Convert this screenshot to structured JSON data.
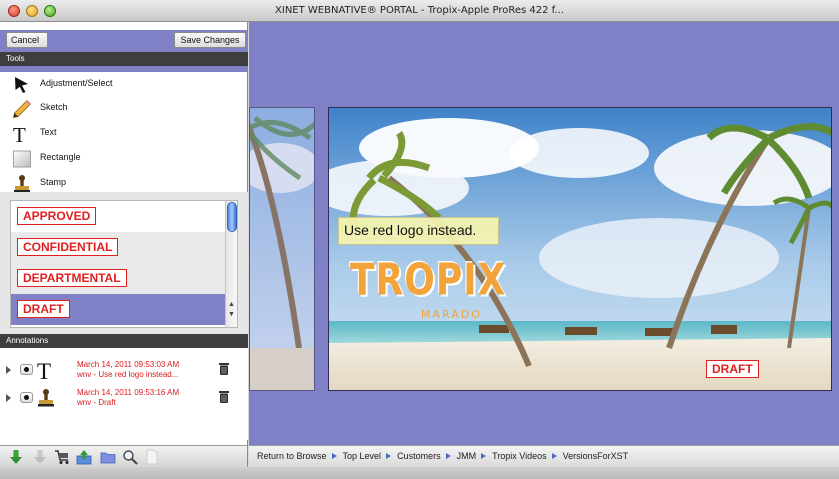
{
  "window": {
    "title": "XINET WEBNATIVE® PORTAL - Tropix-Apple ProRes 422 f..."
  },
  "toolbar": {
    "cancel_label": "Cancel",
    "save_label": "Save Changes"
  },
  "tools": {
    "header": "Tools",
    "items": [
      {
        "label": "Adjustment/Select",
        "icon": "arrow-cursor-icon"
      },
      {
        "label": "Sketch",
        "icon": "pencil-icon"
      },
      {
        "label": "Text",
        "icon": "text-t-icon"
      },
      {
        "label": "Rectangle",
        "icon": "rectangle-icon"
      },
      {
        "label": "Stamp",
        "icon": "stamp-icon"
      }
    ]
  },
  "stamps": {
    "items": [
      "APPROVED",
      "CONFIDENTIAL",
      "DEPARTMENTAL",
      "DRAFT"
    ],
    "selected": "DRAFT"
  },
  "annotations": {
    "header": "Annotations",
    "items": [
      {
        "date": "March 14, 2011 09:53:03 AM",
        "desc": "wnv - Use red logo instead...",
        "type": "text-t-icon"
      },
      {
        "date": "March 14, 2011 09:53:16 AM",
        "desc": "wnv - Draft",
        "type": "stamp-icon"
      }
    ]
  },
  "viewer": {
    "note_text": "Use red logo instead.",
    "stamp_text": "DRAFT",
    "logo_text": "TROPIX",
    "logo_sub": "MARADO"
  },
  "breadcrumb": {
    "items": [
      "Return to Browse",
      "Top Level",
      "Customers",
      "JMM",
      "Tropix Videos",
      "VersionsForXST"
    ]
  },
  "colors": {
    "accent_purple": "#7f80c5",
    "stamp_red": "#e02020",
    "annotation_red": "#d91c1c",
    "note_yellow": "#f6f4ae"
  }
}
